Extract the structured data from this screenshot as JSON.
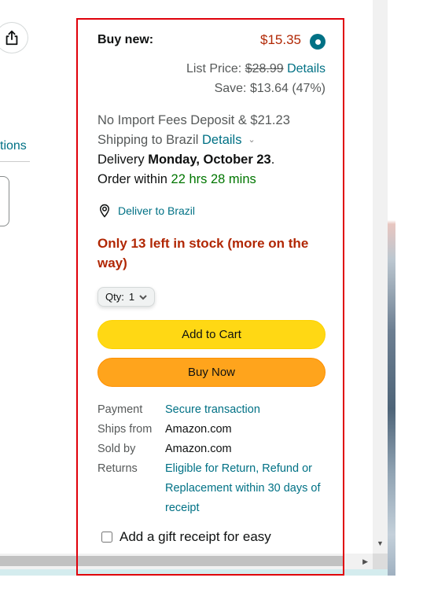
{
  "left_column": {
    "share_icon": "share-icon",
    "link_fragment": "tions"
  },
  "buy_box": {
    "buy_new_label": "Buy new:",
    "price": "$15.35",
    "list_price_label": "List Price:",
    "list_price_value": "$28.99",
    "list_price_details": "Details",
    "save_text": "Save: $13.64 (47%)",
    "import_fees_line1": "No Import Fees Deposit & $21.23",
    "import_fees_line2": "Shipping to Brazil",
    "import_fees_details": "Details",
    "delivery_prefix": "Delivery",
    "delivery_date": "Monday, October 23",
    "delivery_suffix": ".",
    "order_within_prefix": "Order within",
    "order_within_time": "22 hrs 28 mins",
    "deliver_to": "Deliver to Brazil",
    "stock": "Only 13 left in stock (more on the way)",
    "qty_label": "Qty:",
    "qty_value": "1",
    "add_to_cart": "Add to Cart",
    "buy_now": "Buy Now",
    "info": {
      "payment_key": "Payment",
      "payment_value": "Secure transaction",
      "ships_from_key": "Ships from",
      "ships_from_value": "Amazon.com",
      "sold_by_key": "Sold by",
      "sold_by_value": "Amazon.com",
      "returns_key": "Returns",
      "returns_value": "Eligible for Return, Refund or Replacement within 30 days of receipt"
    },
    "gift_receipt": "Add a gift receipt for easy"
  },
  "colors": {
    "price_red": "#b12704",
    "link_teal": "#007185",
    "green": "#007600",
    "add_to_cart_yellow": "#ffd814",
    "buy_now_orange": "#ffa41c",
    "highlight_outline": "#e0000a"
  }
}
